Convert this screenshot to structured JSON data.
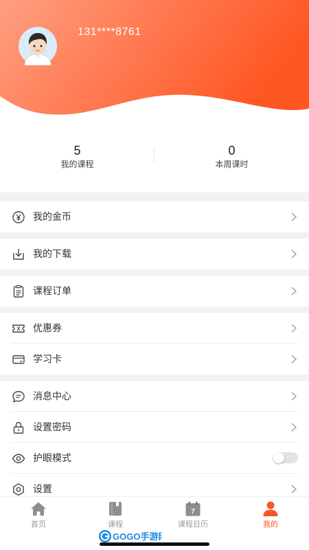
{
  "colors": {
    "accent": "#f4582a",
    "header_gradient_start": "#ff9e7f",
    "header_gradient_end": "#ff5a26"
  },
  "user": {
    "phone": "131****8761",
    "avatar_icon": "boy-avatar-icon"
  },
  "stats": [
    {
      "value": "5",
      "label": "我的课程"
    },
    {
      "value": "0",
      "label": "本周课时"
    }
  ],
  "menu": {
    "coins": {
      "label": "我的金币",
      "icon": "yen-coin-icon"
    },
    "downloads": {
      "label": "我的下载",
      "icon": "download-icon"
    },
    "orders": {
      "label": "课程订单",
      "icon": "clipboard-icon"
    },
    "coupons": {
      "label": "优惠券",
      "icon": "ticket-icon"
    },
    "study_card": {
      "label": "学习卡",
      "icon": "card-icon"
    },
    "messages": {
      "label": "消息中心",
      "icon": "message-icon"
    },
    "password": {
      "label": "设置密码",
      "icon": "lock-icon"
    },
    "eye_mode": {
      "label": "护眼模式",
      "icon": "eye-icon",
      "enabled": false
    },
    "settings": {
      "label": "设置",
      "icon": "settings-icon"
    }
  },
  "tabs": [
    {
      "label": "首页",
      "icon": "home-icon",
      "active": false
    },
    {
      "label": "课程",
      "icon": "book-icon",
      "active": false
    },
    {
      "label": "课程日历",
      "icon": "calendar-icon",
      "active": false,
      "badge": "7"
    },
    {
      "label": "我的",
      "icon": "person-icon",
      "active": true
    }
  ],
  "watermark": {
    "text": "GOGO手游网",
    "icon": "gogo-logo-icon"
  }
}
